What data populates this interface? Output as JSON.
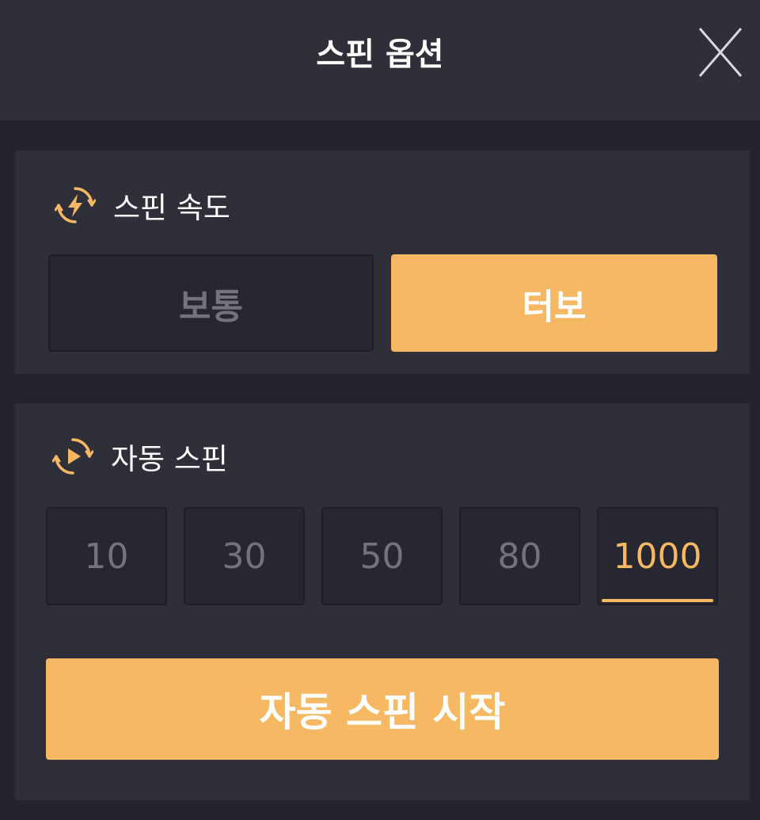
{
  "header": {
    "title": "스핀 옵션",
    "close_icon": "close-icon"
  },
  "spin_speed": {
    "title": "스핀 속도",
    "icon": "lightning-icon",
    "options": [
      {
        "label": "보통",
        "selected": false
      },
      {
        "label": "터보",
        "selected": true
      }
    ]
  },
  "auto_spin": {
    "title": "자동 스핀",
    "icon": "play-cycle-icon",
    "counts": [
      {
        "label": "10",
        "selected": false
      },
      {
        "label": "30",
        "selected": false
      },
      {
        "label": "50",
        "selected": false
      },
      {
        "label": "80",
        "selected": false
      },
      {
        "label": "1000",
        "selected": true
      }
    ],
    "start_label": "자동 스핀 시작"
  },
  "colors": {
    "accent": "#f6b863",
    "background": "#24242e",
    "panel": "#2f2f3a",
    "inactive_text": "#737380"
  }
}
